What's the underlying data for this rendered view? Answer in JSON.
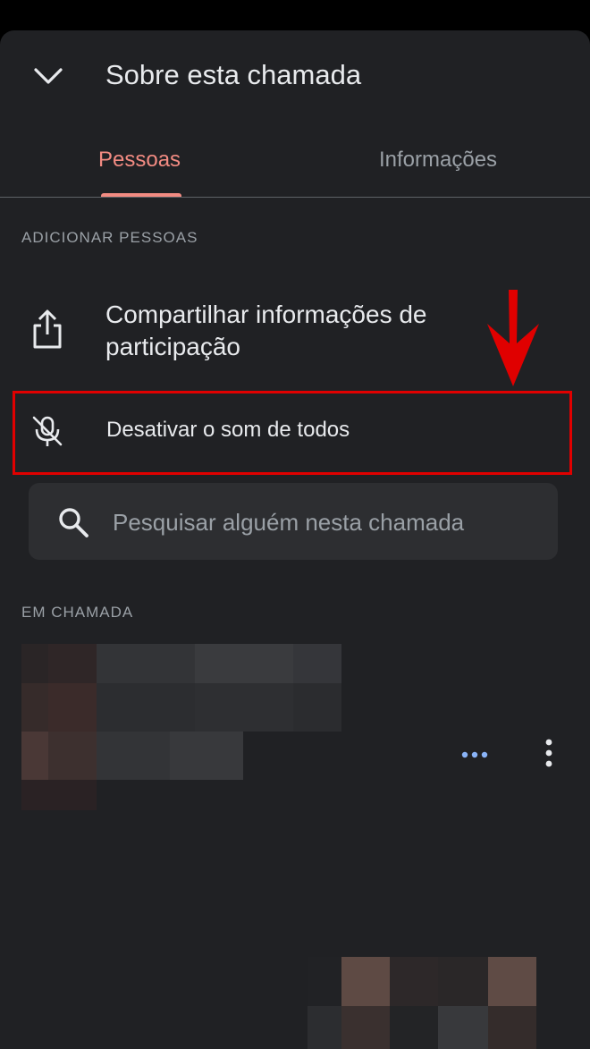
{
  "header": {
    "title": "Sobre esta chamada",
    "collapse_icon": "chevron-down-icon"
  },
  "tabs": [
    {
      "label": "Pessoas",
      "selected": true
    },
    {
      "label": "Informações",
      "selected": false
    }
  ],
  "add_people": {
    "section_label": "ADICIONAR PESSOAS",
    "share": {
      "label": "Compartilhar informações de participação",
      "icon": "share-icon"
    },
    "mute_all": {
      "label": "Desativar o som de todos",
      "icon": "mic-off-icon"
    }
  },
  "search": {
    "placeholder": "Pesquisar alguém nesta chamada",
    "value": "",
    "icon": "search-icon"
  },
  "in_call": {
    "section_label": "EM CHAMADA",
    "participant_icons": [
      "speaking-dots-icon",
      "more-vert-icon"
    ]
  },
  "colors": {
    "accent": "#f28b82",
    "background": "#202124",
    "highlight_border": "#e00000",
    "dots": "#8ab4f8"
  }
}
